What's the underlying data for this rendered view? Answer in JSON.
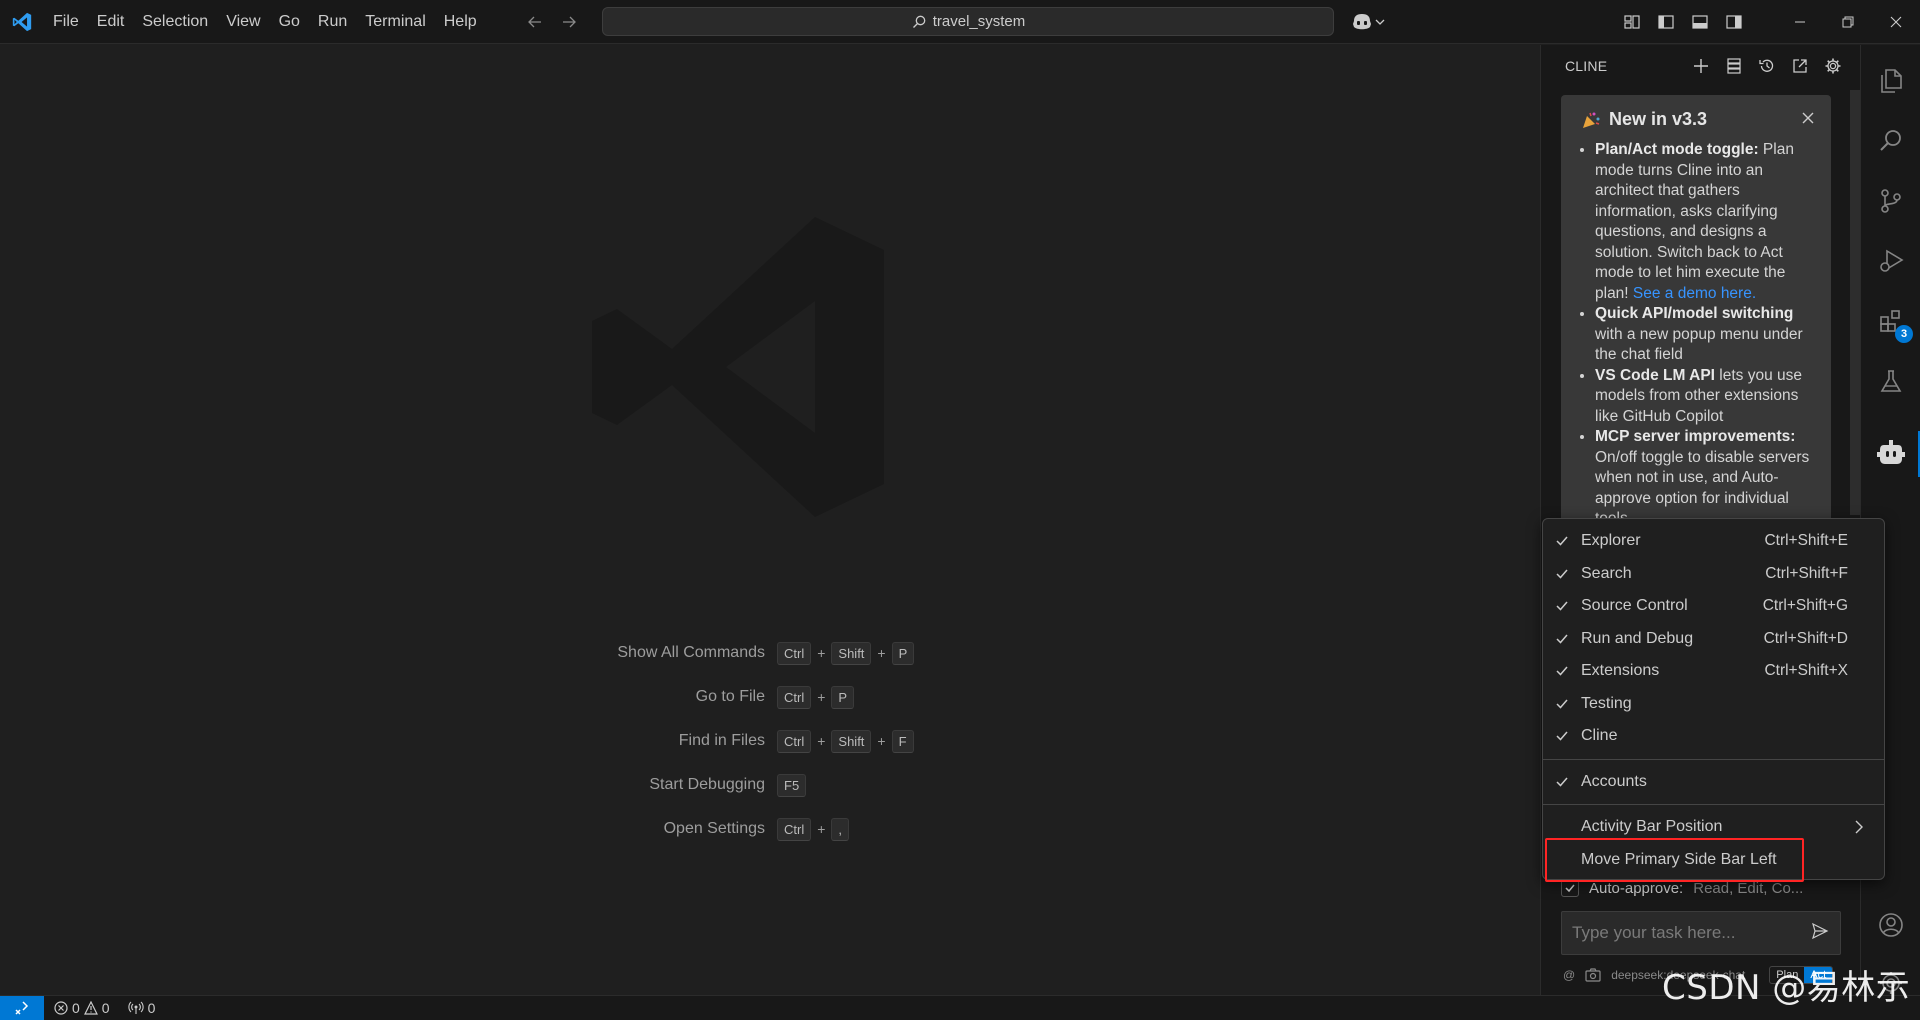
{
  "titlebar": {
    "menus": [
      "File",
      "Edit",
      "Selection",
      "View",
      "Go",
      "Run",
      "Terminal",
      "Help"
    ],
    "search_text": "travel_system"
  },
  "editor": {
    "shortcuts": [
      {
        "label": "Show All Commands",
        "keys": [
          "Ctrl",
          "Shift",
          "P"
        ]
      },
      {
        "label": "Go to File",
        "keys": [
          "Ctrl",
          "P"
        ]
      },
      {
        "label": "Find in Files",
        "keys": [
          "Ctrl",
          "Shift",
          "F"
        ]
      },
      {
        "label": "Start Debugging",
        "keys": [
          "F5"
        ]
      },
      {
        "label": "Open Settings",
        "keys": [
          "Ctrl",
          ","
        ]
      }
    ]
  },
  "panel": {
    "title": "CLINE",
    "announcement": {
      "title": "New in v3.3",
      "items": [
        {
          "bold": "Plan/Act mode toggle:",
          "text": " Plan mode turns Cline into an architect that gathers information, asks clarifying questions, and designs a solution. Switch back to Act mode to let him execute the plan! ",
          "link": "See a demo here."
        },
        {
          "bold": "Quick API/model switching",
          "text": " with a new popup menu under the chat field",
          "link": ""
        },
        {
          "bold": "VS Code LM API",
          "text": " lets you use models from other extensions like GitHub Copilot",
          "link": ""
        },
        {
          "bold": "MCP server improvements:",
          "text": " On/off toggle to disable servers when not in use, and Auto-approve option for individual tools",
          "link": ""
        }
      ]
    },
    "auto_approve_label": "Auto-approve:",
    "auto_approve_detail": "Read, Edit, Co...",
    "input_placeholder": "Type your task here...",
    "footer": {
      "at": "@",
      "model": "deepseek:deepseek-chat",
      "plan": "Plan",
      "act": "Act"
    }
  },
  "activitybar": {
    "extensions_badge": "3"
  },
  "context_menu": {
    "items": [
      {
        "label": "Explorer",
        "shortcut": "Ctrl+Shift+E",
        "checked": true
      },
      {
        "label": "Search",
        "shortcut": "Ctrl+Shift+F",
        "checked": true
      },
      {
        "label": "Source Control",
        "shortcut": "Ctrl+Shift+G",
        "checked": true
      },
      {
        "label": "Run and Debug",
        "shortcut": "Ctrl+Shift+D",
        "checked": true
      },
      {
        "label": "Extensions",
        "shortcut": "Ctrl+Shift+X",
        "checked": true
      },
      {
        "label": "Testing",
        "shortcut": "",
        "checked": true
      },
      {
        "label": "Cline",
        "shortcut": "",
        "checked": true
      }
    ],
    "accounts": "Accounts",
    "activity_bar_position": "Activity Bar Position",
    "move_primary": "Move Primary Side Bar Left"
  },
  "statusbar": {
    "errors": "0",
    "warnings": "0",
    "ports": "0"
  },
  "watermark": "CSDN @易林示",
  "colors": {
    "accent": "#0078d4",
    "highlight": "#ff2424",
    "link": "#3794ff"
  }
}
